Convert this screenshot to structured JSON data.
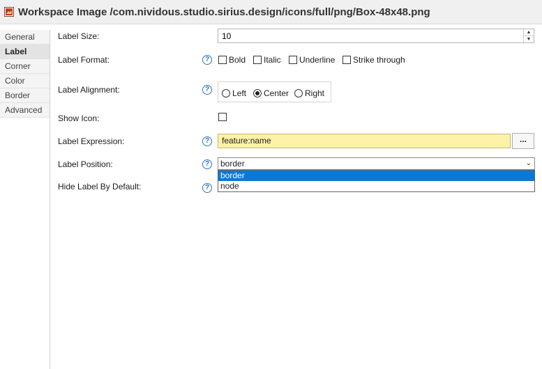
{
  "window": {
    "title": "Workspace Image /com.nividous.studio.sirius.design/icons/full/png/Box-48x48.png"
  },
  "tabs": [
    {
      "label": "General",
      "active": false
    },
    {
      "label": "Label",
      "active": true
    },
    {
      "label": "Corner",
      "active": false
    },
    {
      "label": "Color",
      "active": false
    },
    {
      "label": "Border",
      "active": false
    },
    {
      "label": "Advanced",
      "active": false
    }
  ],
  "form": {
    "label_size": {
      "label": "Label Size:",
      "value": "10"
    },
    "label_format": {
      "label": "Label Format:",
      "options": [
        "Bold",
        "Italic",
        "Underline",
        "Strike through"
      ]
    },
    "label_alignment": {
      "label": "Label Alignment:",
      "options": [
        "Left",
        "Center",
        "Right"
      ],
      "selected": "Center"
    },
    "show_icon": {
      "label": "Show Icon:",
      "checked": false
    },
    "label_expression": {
      "label": "Label Expression:",
      "value": "feature:name",
      "button": "..."
    },
    "label_position": {
      "label": "Label Position:",
      "value": "border",
      "options": [
        "border",
        "node"
      ],
      "highlighted": "border"
    },
    "hide_label": {
      "label": "Hide Label By Default:"
    }
  },
  "icons": {
    "help": "?",
    "spin_up": "▲",
    "spin_down": "▼",
    "combo_arrow": "⌄"
  },
  "colors": {
    "expression_bg": "#fdf2a8",
    "selection": "#0a78d7",
    "help_icon": "#2f74c0"
  }
}
